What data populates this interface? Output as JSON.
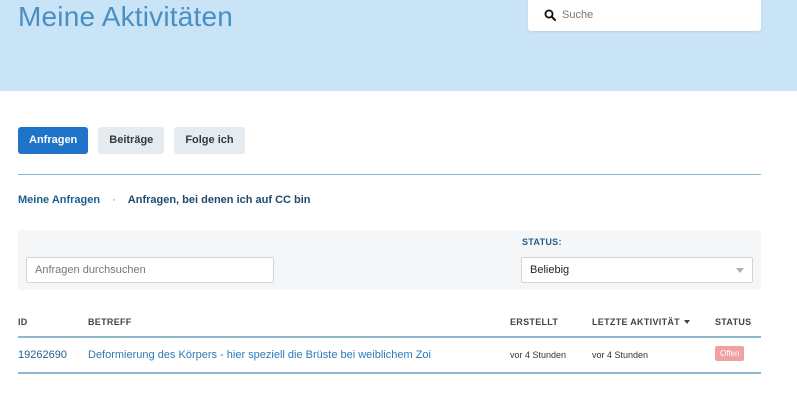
{
  "header": {
    "title": "Meine Aktivitäten",
    "search": {
      "placeholder": "Suche",
      "value": ""
    }
  },
  "tabs": [
    {
      "label": "Anfragen",
      "active": true
    },
    {
      "label": "Beiträge",
      "active": false
    },
    {
      "label": "Folge ich",
      "active": false
    }
  ],
  "subnav": {
    "primary": "Meine Anfragen",
    "separator": "·",
    "secondary": "Anfragen, bei denen ich auf CC bin"
  },
  "filter": {
    "search_placeholder": "Anfragen durchsuchen",
    "status_label": "STATUS:",
    "status_value": "Beliebig"
  },
  "table": {
    "columns": {
      "id": "ID",
      "subject": "BETREFF",
      "created": "ERSTELLT",
      "last_activity": "LETZTE AKTIVITÄT",
      "status": "STATUS"
    },
    "rows": [
      {
        "id": "19262690",
        "subject": "Deformierung des Körpers - hier speziell die Brüste bei weiblichem Zoi",
        "created": "vor 4 Stunden",
        "last_activity": "vor 4 Stunden",
        "status": "Offen"
      }
    ]
  },
  "colors": {
    "hero_background": "#c9e4f6",
    "accent": "#1f73c9",
    "link": "#2d7ab8",
    "status_open": "#f1a1a1"
  },
  "icons": {
    "search": "search-icon",
    "sort": "sort-desc-icon",
    "dropdown": "chevron-down-icon"
  }
}
